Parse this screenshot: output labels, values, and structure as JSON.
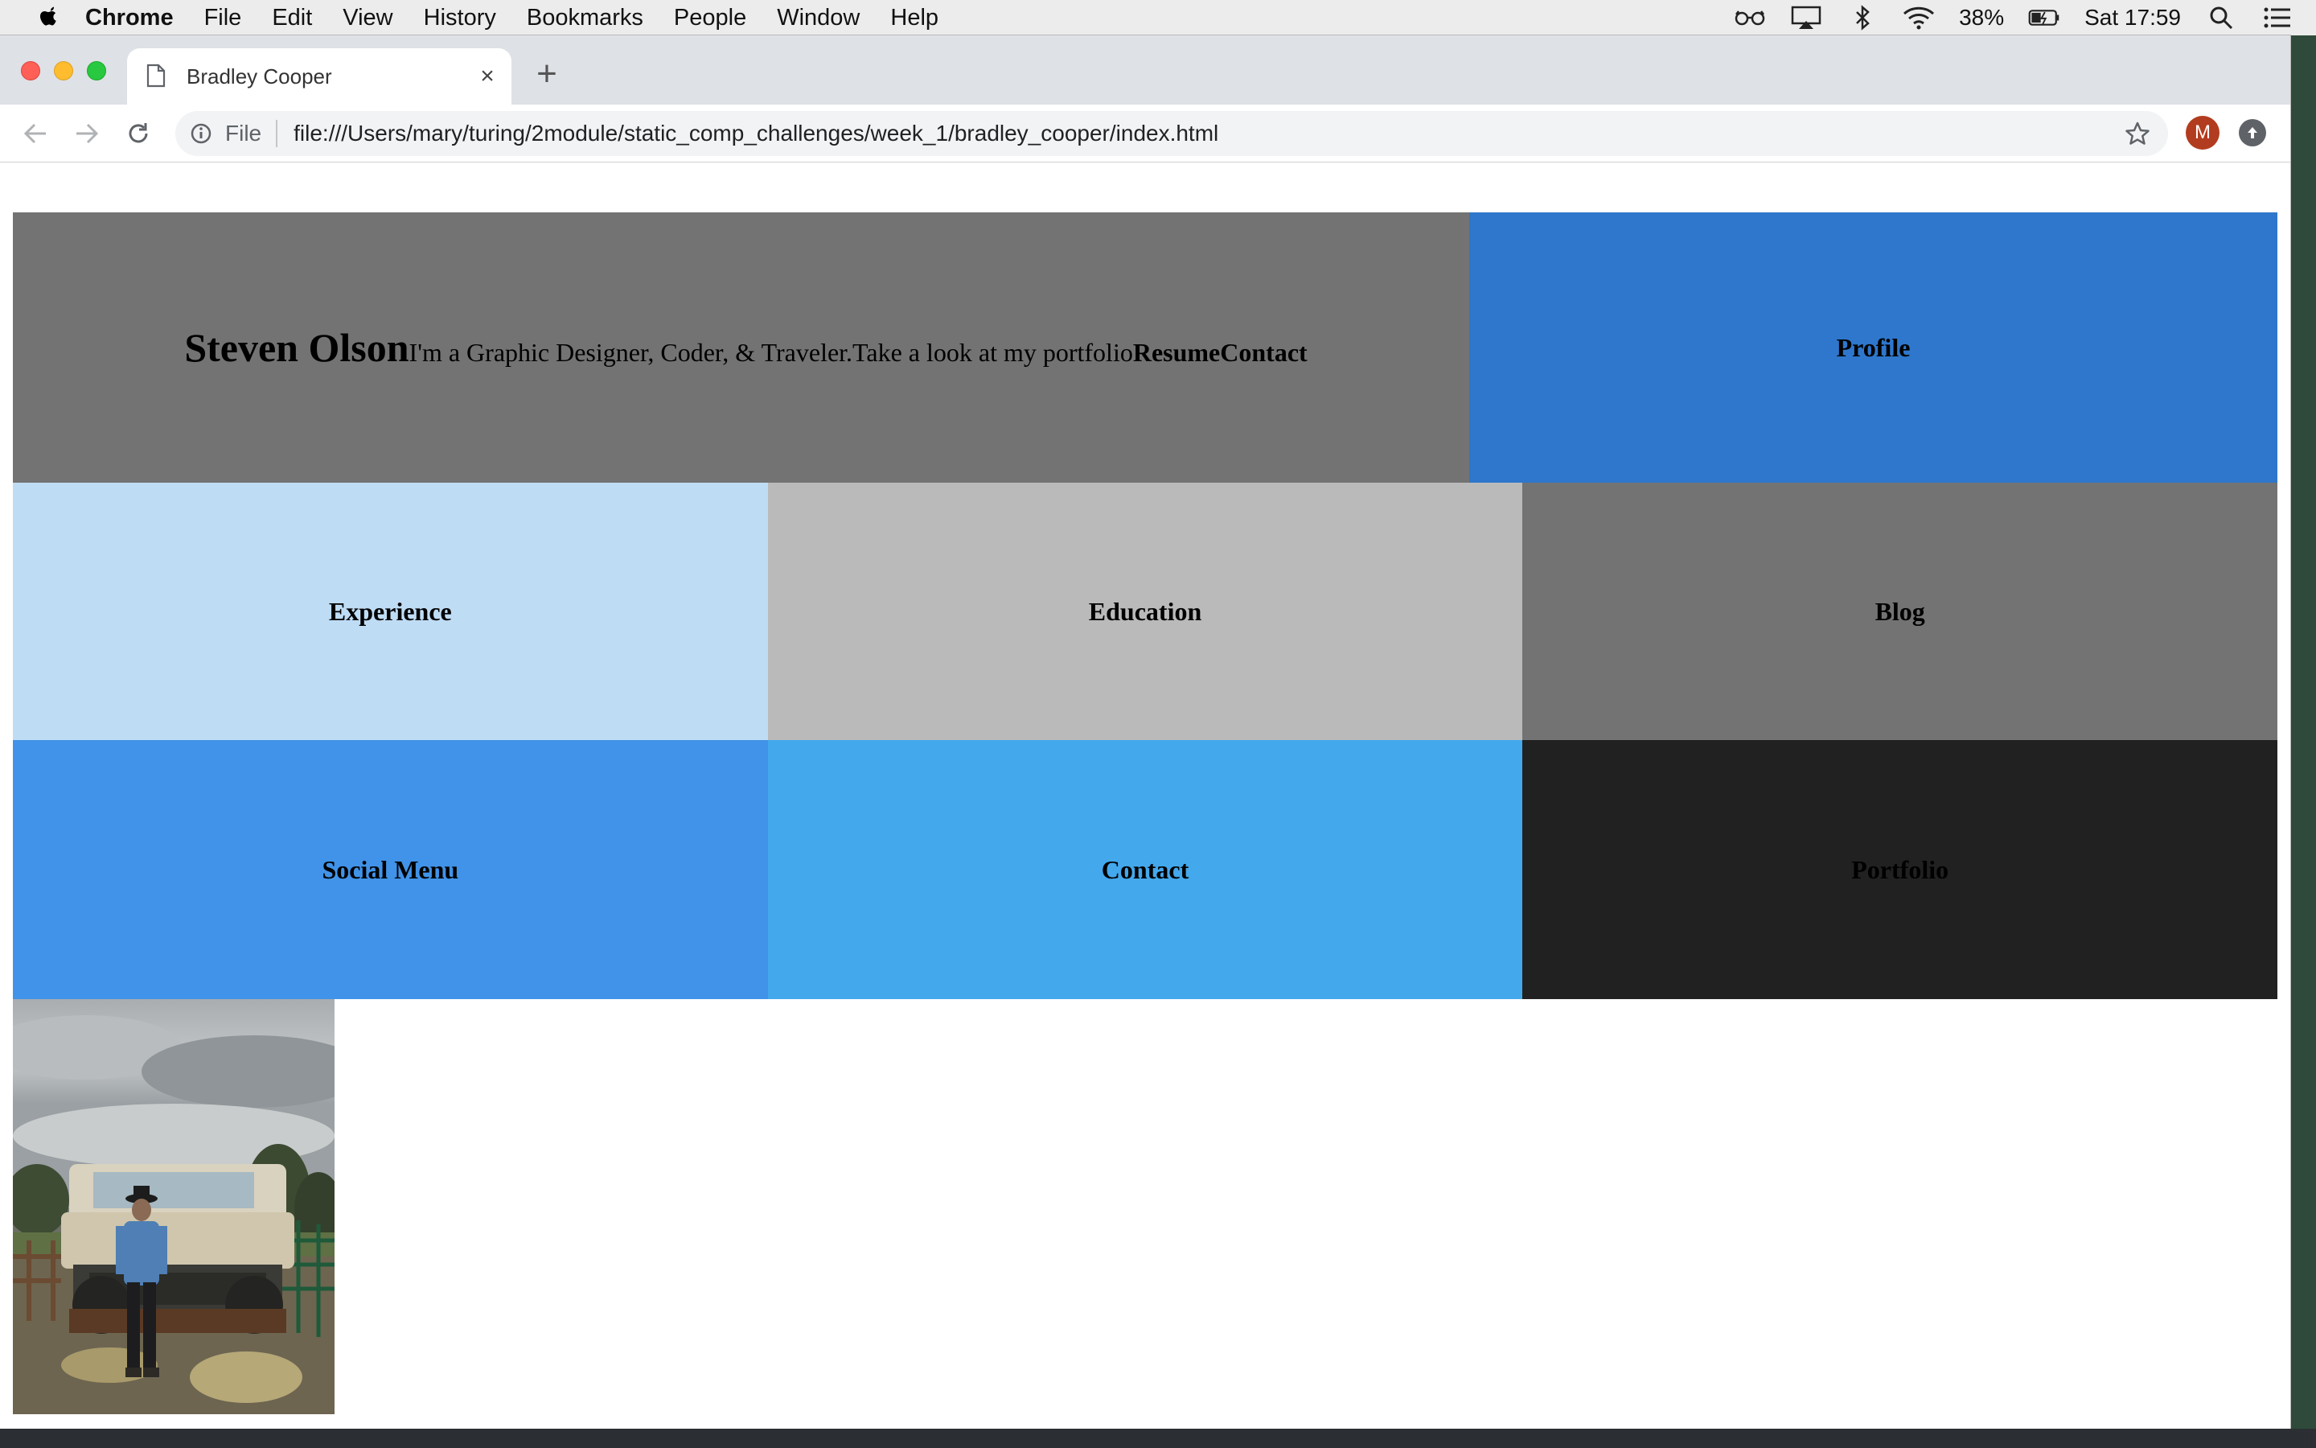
{
  "menubar": {
    "app_name": "Chrome",
    "items": [
      "File",
      "Edit",
      "View",
      "History",
      "Bookmarks",
      "People",
      "Window",
      "Help"
    ],
    "battery": "38%",
    "clock": "Sat 17:59"
  },
  "browser": {
    "tab_title": "Bradley Cooper",
    "new_tab_glyph": "+",
    "close_glyph": "×",
    "scheme_label": "File",
    "url": "file:///Users/mary/turing/2module/static_comp_challenges/week_1/bradley_cooper/index.html",
    "profile_initial": "M"
  },
  "page": {
    "header": {
      "name": "Steven Olson",
      "tagline": "I'm a Graphic Designer, Coder, & Traveler.",
      "portfolio_text": "Take a look at my portfolio",
      "link_resume": "Resume",
      "link_contact": "Contact"
    },
    "tiles": {
      "profile": "Profile",
      "experience": "Experience",
      "education": "Education",
      "blog": "Blog",
      "social_menu": "Social Menu",
      "contact": "Contact",
      "portfolio": "Portfolio"
    },
    "colors": {
      "header": "#737373",
      "profile": "#2e77cc",
      "experience": "#bfdcf5",
      "education": "#bababa",
      "blog": "#737373",
      "social_menu": "#4093e8",
      "contact": "#43a8ec",
      "portfolio": "#212121"
    }
  },
  "icons": [
    "apple-icon",
    "reading-glasses-icon",
    "airplay-icon",
    "bluetooth-icon",
    "wifi-icon",
    "battery-icon",
    "spotlight-search-icon",
    "notification-center-icon",
    "document-icon",
    "back-arrow-icon",
    "forward-arrow-icon",
    "reload-icon",
    "info-icon",
    "bookmark-star-icon",
    "extension-icon"
  ]
}
